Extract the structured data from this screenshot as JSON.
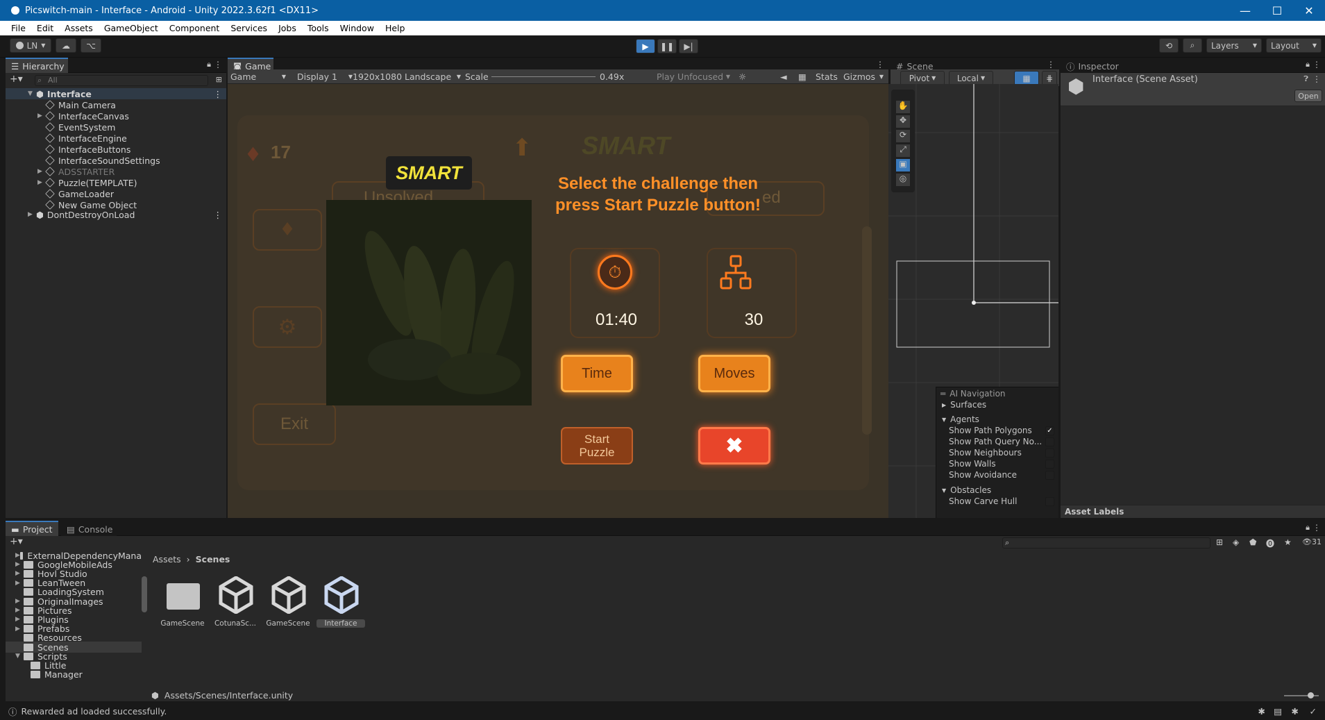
{
  "window": {
    "title": "Picswitch-main - Interface - Android - Unity 2022.3.62f1 <DX11>",
    "minimize": "—",
    "maximize": "☐",
    "close": "✕"
  },
  "menu": [
    "File",
    "Edit",
    "Assets",
    "GameObject",
    "Component",
    "Services",
    "Jobs",
    "Tools",
    "Window",
    "Help"
  ],
  "toolbar": {
    "account": "LN",
    "layers": "Layers",
    "layout": "Layout"
  },
  "hierarchy": {
    "tab": "Hierarchy",
    "search_placeholder": "All",
    "scene": "Interface",
    "items": [
      {
        "label": "Main Camera",
        "expandable": false,
        "disabled": false
      },
      {
        "label": "InterfaceCanvas",
        "expandable": true,
        "disabled": false
      },
      {
        "label": "EventSystem",
        "expandable": false,
        "disabled": false
      },
      {
        "label": "InterfaceEngine",
        "expandable": false,
        "disabled": false
      },
      {
        "label": "InterfaceButtons",
        "expandable": false,
        "disabled": false
      },
      {
        "label": "InterfaceSoundSettings",
        "expandable": false,
        "disabled": false
      },
      {
        "label": "ADSSTARTER",
        "expandable": true,
        "disabled": true
      },
      {
        "label": "Puzzle(TEMPLATE)",
        "expandable": true,
        "disabled": false
      },
      {
        "label": "GameLoader",
        "expandable": false,
        "disabled": false
      },
      {
        "label": "New Game Object",
        "expandable": false,
        "disabled": false
      }
    ],
    "dont_destroy": "DontDestroyOnLoad"
  },
  "game": {
    "tab": "Game",
    "view_select": "Game",
    "display": "Display 1",
    "resolution": "1920x1080 Landscape",
    "scale_label": "Scale",
    "scale_value": "0.49x",
    "play_mode": "Play Unfocused",
    "stats": "Stats",
    "gizmos": "Gizmos",
    "bg_gems": "17",
    "bg_title": "SMART",
    "bg_unsolved": "Unsolved",
    "bg_solved": "ed",
    "bg_exit": "Exit",
    "logo": "SMART",
    "dialog_title": "Select the challenge then press Start Puzzle button!",
    "time_value": "01:40",
    "moves_value": "30",
    "time_button": "Time",
    "moves_button": "Moves",
    "start_button": "Start Puzzle",
    "close_icon": "close-x-icon"
  },
  "scene": {
    "tab": "Scene",
    "pivot": "Pivot",
    "local": "Local",
    "ai_nav": {
      "title": "AI Navigation",
      "surfaces": "Surfaces",
      "agents": "Agents",
      "agent_rows": [
        {
          "label": "Show Path Polygons",
          "checked": true
        },
        {
          "label": "Show Path Query No...",
          "checked": false
        },
        {
          "label": "Show Neighbours",
          "checked": false
        },
        {
          "label": "Show Walls",
          "checked": false
        },
        {
          "label": "Show Avoidance",
          "checked": false
        }
      ],
      "obstacles": "Obstacles",
      "obstacle_rows": [
        {
          "label": "Show Carve Hull",
          "checked": false
        }
      ]
    }
  },
  "inspector": {
    "tab": "Inspector",
    "asset_title": "Interface (Scene Asset)",
    "open_button": "Open",
    "asset_labels": "Asset Labels"
  },
  "project": {
    "tab_project": "Project",
    "tab_console": "Console",
    "hidden_count": "31",
    "folders": [
      {
        "label": "ExternalDependencyMana",
        "expandable": true,
        "indent": 0
      },
      {
        "label": "GoogleMobileAds",
        "expandable": true,
        "indent": 0
      },
      {
        "label": "Hovl Studio",
        "expandable": true,
        "indent": 0
      },
      {
        "label": "LeanTween",
        "expandable": true,
        "indent": 0
      },
      {
        "label": "LoadingSystem",
        "expandable": false,
        "indent": 0
      },
      {
        "label": "OriginalImages",
        "expandable": true,
        "indent": 0
      },
      {
        "label": "Pictures",
        "expandable": true,
        "indent": 0
      },
      {
        "label": "Plugins",
        "expandable": true,
        "indent": 0
      },
      {
        "label": "Prefabs",
        "expandable": true,
        "indent": 0
      },
      {
        "label": "Resources",
        "expandable": false,
        "indent": 0
      },
      {
        "label": "Scenes",
        "expandable": false,
        "indent": 0,
        "selected": true
      },
      {
        "label": "Scripts",
        "expandable": true,
        "indent": 0,
        "open": true
      },
      {
        "label": "Little",
        "expandable": false,
        "indent": 1
      },
      {
        "label": "Manager",
        "expandable": false,
        "indent": 1
      }
    ],
    "breadcrumb_root": "Assets",
    "breadcrumb_current": "Scenes",
    "assets": [
      {
        "label": "GameScene",
        "kind": "folder"
      },
      {
        "label": "CotunaSc...",
        "kind": "unity"
      },
      {
        "label": "GameScene",
        "kind": "unity"
      },
      {
        "label": "Interface",
        "kind": "unity",
        "selected": true
      }
    ],
    "path": "Assets/Scenes/Interface.unity"
  },
  "status": {
    "message": "Rewarded ad loaded successfully."
  },
  "colors": {
    "accent_blue": "#0a5fa3",
    "tab_highlight": "#3a79bb",
    "game_orange": "#ff9028",
    "close_red": "#e8452a"
  }
}
